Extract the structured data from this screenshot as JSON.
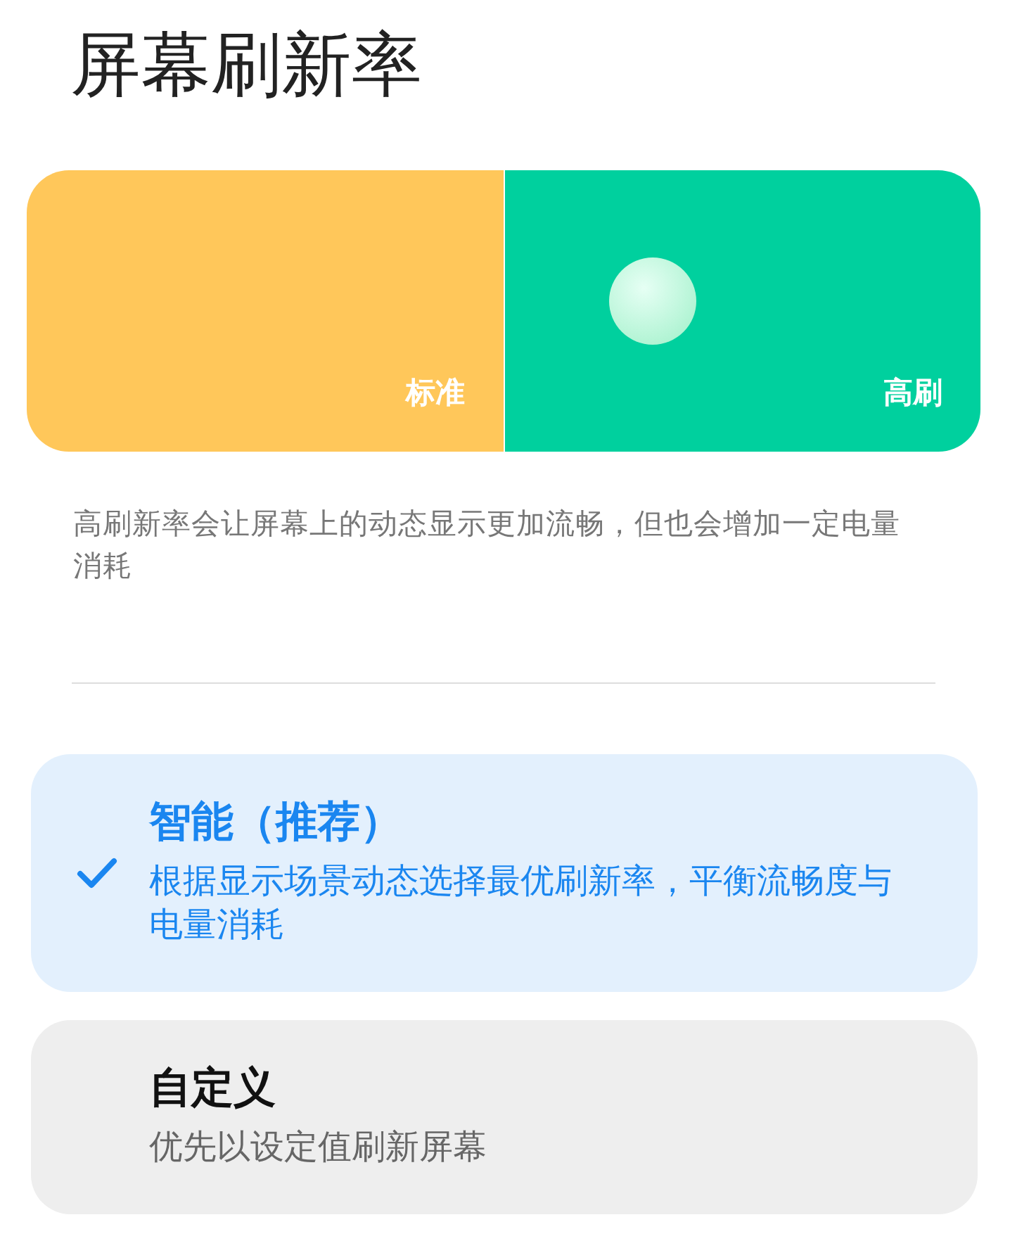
{
  "title": "屏幕刷新率",
  "modes": [
    {
      "label": "标准",
      "selected": false,
      "color": "#ffc75a"
    },
    {
      "label": "高刷",
      "selected": true,
      "color": "#00d09e"
    }
  ],
  "description": "高刷新率会让屏幕上的动态显示更加流畅，但也会增加一定电量消耗",
  "options": [
    {
      "title": "智能（推荐）",
      "subtitle": "根据显示场景动态选择最优刷新率，平衡流畅度与电量消耗",
      "selected": true
    },
    {
      "title": "自定义",
      "subtitle": "优先以设定值刷新屏幕",
      "selected": false
    }
  ]
}
